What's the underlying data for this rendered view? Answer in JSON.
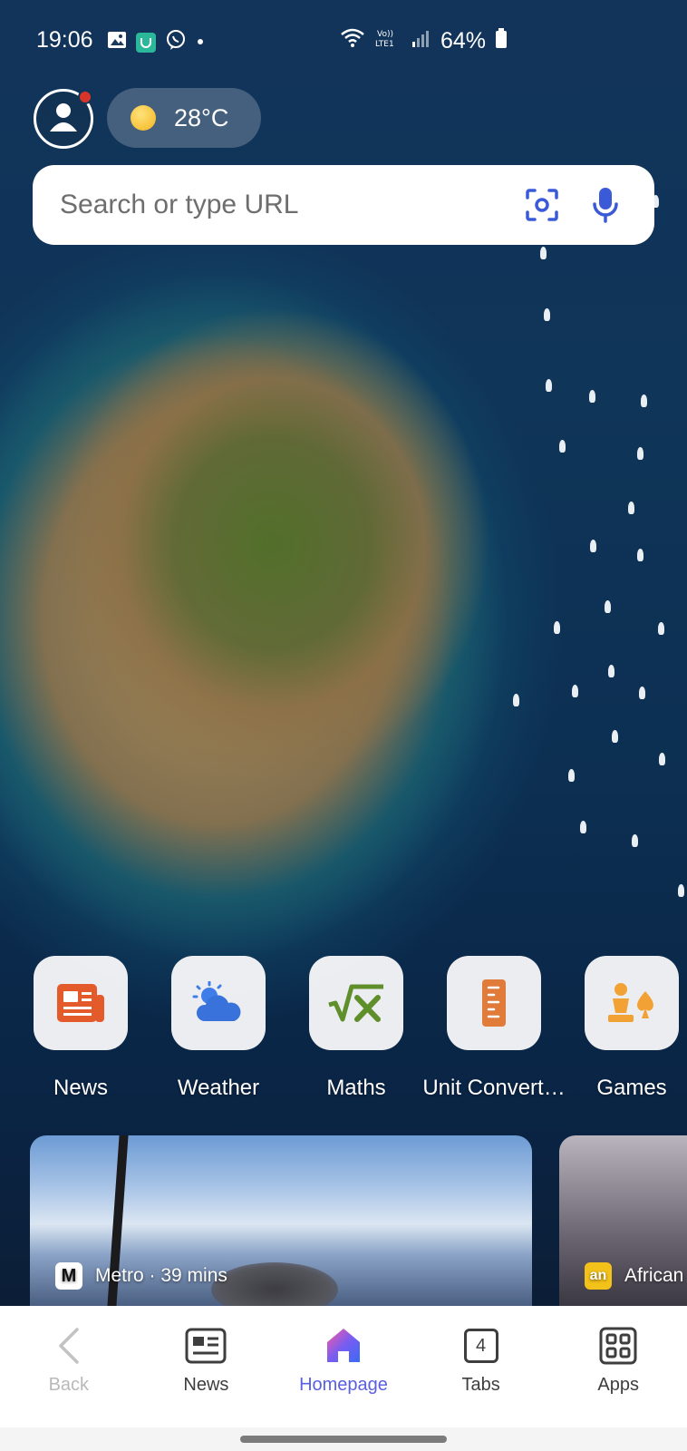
{
  "status_bar": {
    "time": "19:06",
    "battery": "64%",
    "icons": [
      "gallery-icon",
      "mi-home-icon",
      "viber-icon",
      "dot-icon",
      "wifi-icon",
      "volte-icon",
      "signal-icon",
      "battery-icon"
    ]
  },
  "header": {
    "weather_temp": "28°C"
  },
  "search": {
    "placeholder": "Search or type URL"
  },
  "shortcuts": [
    {
      "label": "News",
      "icon": "newspaper-icon",
      "color": "#e35a2b"
    },
    {
      "label": "Weather",
      "icon": "cloud-sun-icon",
      "color": "#3f7ee8"
    },
    {
      "label": "Maths",
      "icon": "sqrt-x-icon",
      "color": "#5f8f2a"
    },
    {
      "label": "Unit Convert…",
      "icon": "ruler-icon",
      "color": "#e07b3a"
    },
    {
      "label": "Games",
      "icon": "chess-spade-icon",
      "color": "#f2a234"
    }
  ],
  "feed": [
    {
      "source": "Metro · 39 mins",
      "logo": "M"
    },
    {
      "source": "African",
      "logo": "an"
    }
  ],
  "bottom_nav": {
    "back": "Back",
    "news": "News",
    "homepage": "Homepage",
    "tabs": "Tabs",
    "tabs_count": "4",
    "apps": "Apps"
  },
  "colors": {
    "accent": "#5a5fe0",
    "notification_dot": "#d8352a"
  }
}
